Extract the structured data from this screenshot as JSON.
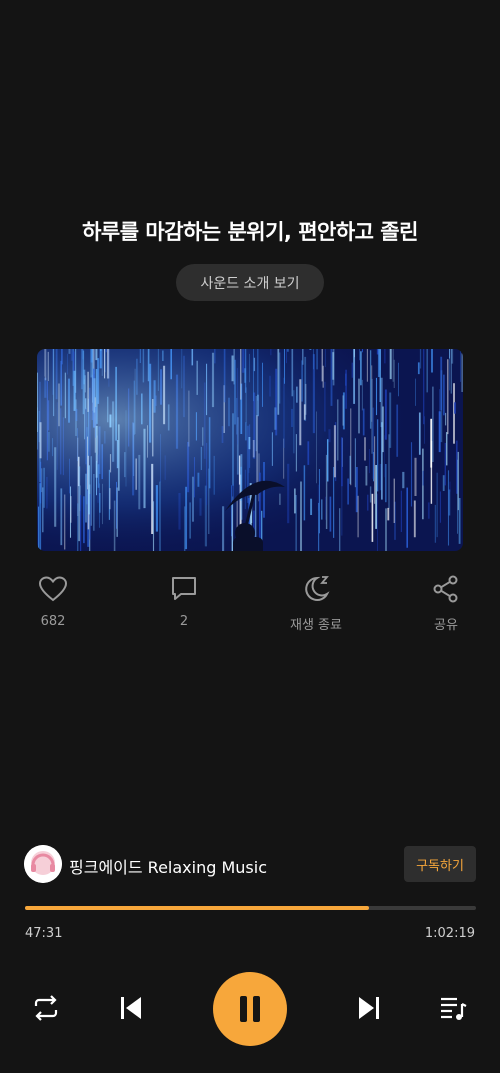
{
  "sound": {
    "title": "하루를 마감하는 분위기, 편안하고 졸린",
    "intro_button": "사운드 소개 보기"
  },
  "actions": {
    "like": {
      "icon": "heart-icon",
      "count": "682"
    },
    "comment": {
      "icon": "comment-icon",
      "count": "2"
    },
    "sleep_timer": {
      "icon": "moon-sleep-icon",
      "label": "재생 종료"
    },
    "share": {
      "icon": "share-icon",
      "label": "공유"
    }
  },
  "channel": {
    "name": "핑크에이드 Relaxing Music",
    "subscribe_label": "구독하기"
  },
  "playback": {
    "current_time": "47:31",
    "total_time": "1:02:19",
    "progress_fraction": 0.762
  },
  "controls": {
    "repeat": "repeat-icon",
    "previous": "skip-previous-icon",
    "play_state": "pause-icon",
    "next": "skip-next-icon",
    "playlist": "playlist-icon"
  },
  "colors": {
    "background": "#141414",
    "accent": "#f7a73b",
    "muted_text": "#9a9a9a"
  }
}
